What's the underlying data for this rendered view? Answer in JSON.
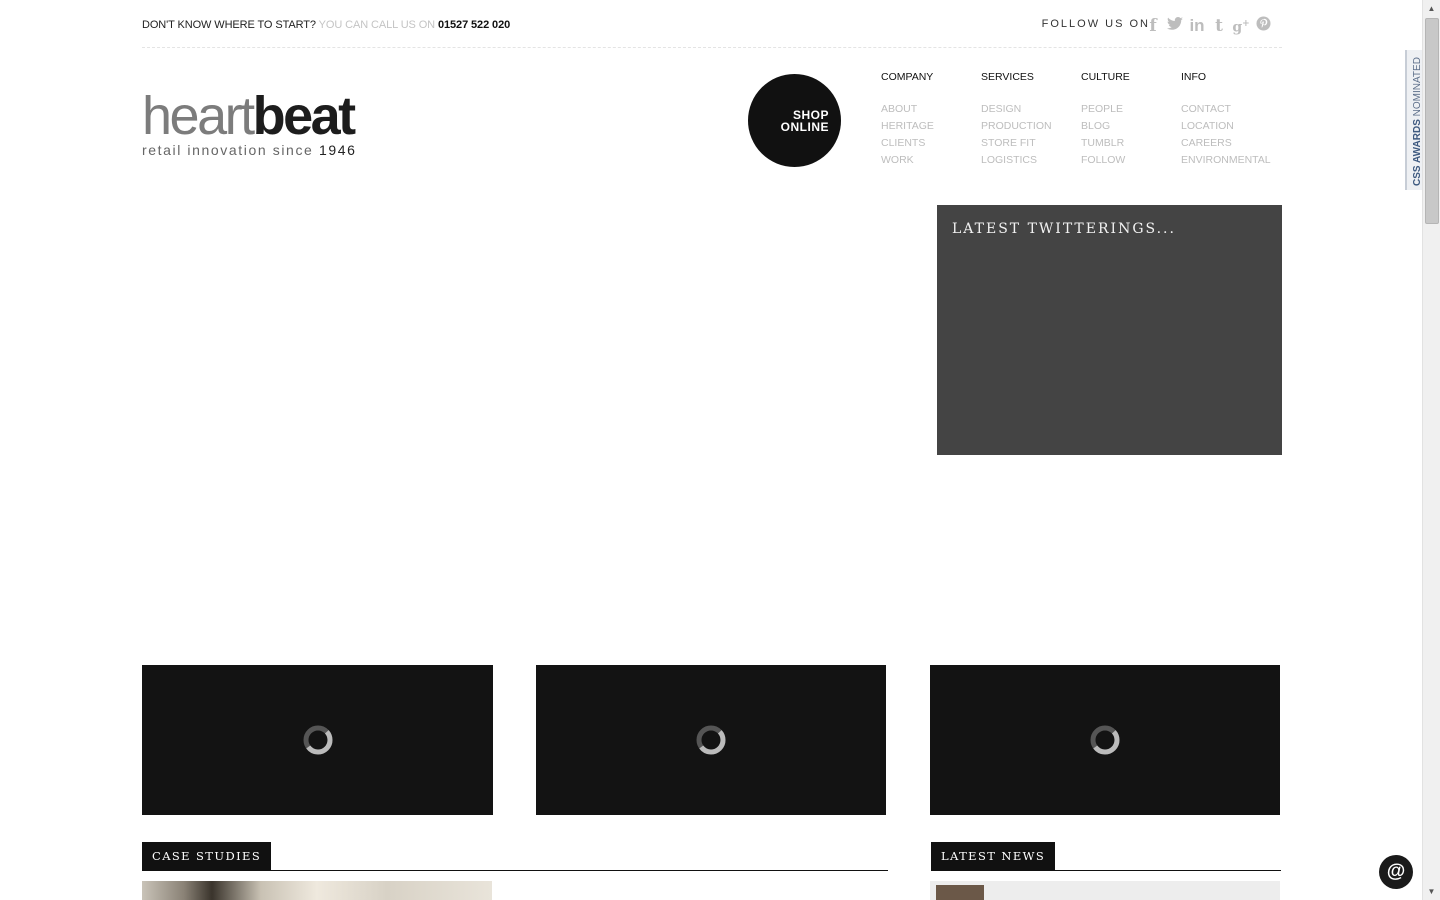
{
  "topbar": {
    "question": "DON'T KNOW WHERE TO START?",
    "call": "YOU CAN CALL US ON",
    "phone": "01527 522 020",
    "follow": "FOLLOW US ON",
    "socials": [
      "facebook-icon",
      "twitter-icon",
      "linkedin-icon",
      "tumblr-icon",
      "googleplus-icon",
      "pinterest-icon"
    ]
  },
  "logo": {
    "light": "heart",
    "bold": "beat",
    "tagline": "retail innovation since",
    "year": "1946"
  },
  "shop": {
    "line1": "SHOP",
    "line2": "ONLINE"
  },
  "nav": [
    {
      "head": "COMPANY",
      "items": [
        "ABOUT",
        "HERITAGE",
        "CLIENTS",
        "WORK"
      ]
    },
    {
      "head": "SERVICES",
      "items": [
        "DESIGN",
        "PRODUCTION",
        "STORE FIT",
        "LOGISTICS"
      ]
    },
    {
      "head": "CULTURE",
      "items": [
        "PEOPLE",
        "BLOG",
        "TUMBLR",
        "FOLLOW"
      ]
    },
    {
      "head": "INFO",
      "items": [
        "CONTACT",
        "LOCATION",
        "CAREERS",
        "ENVIRONMENTAL"
      ]
    }
  ],
  "twitter": {
    "title": "LATEST TWITTERINGS..."
  },
  "sections": {
    "case": "CASE STUDIES",
    "news": "LATEST NEWS"
  },
  "awards": {
    "bold": "CSS AWARDS",
    "rest": "NOMINATED"
  },
  "fab": "@",
  "colors": {
    "accent": "#111111",
    "muted": "#bdbdbd",
    "panel": "#444444"
  }
}
